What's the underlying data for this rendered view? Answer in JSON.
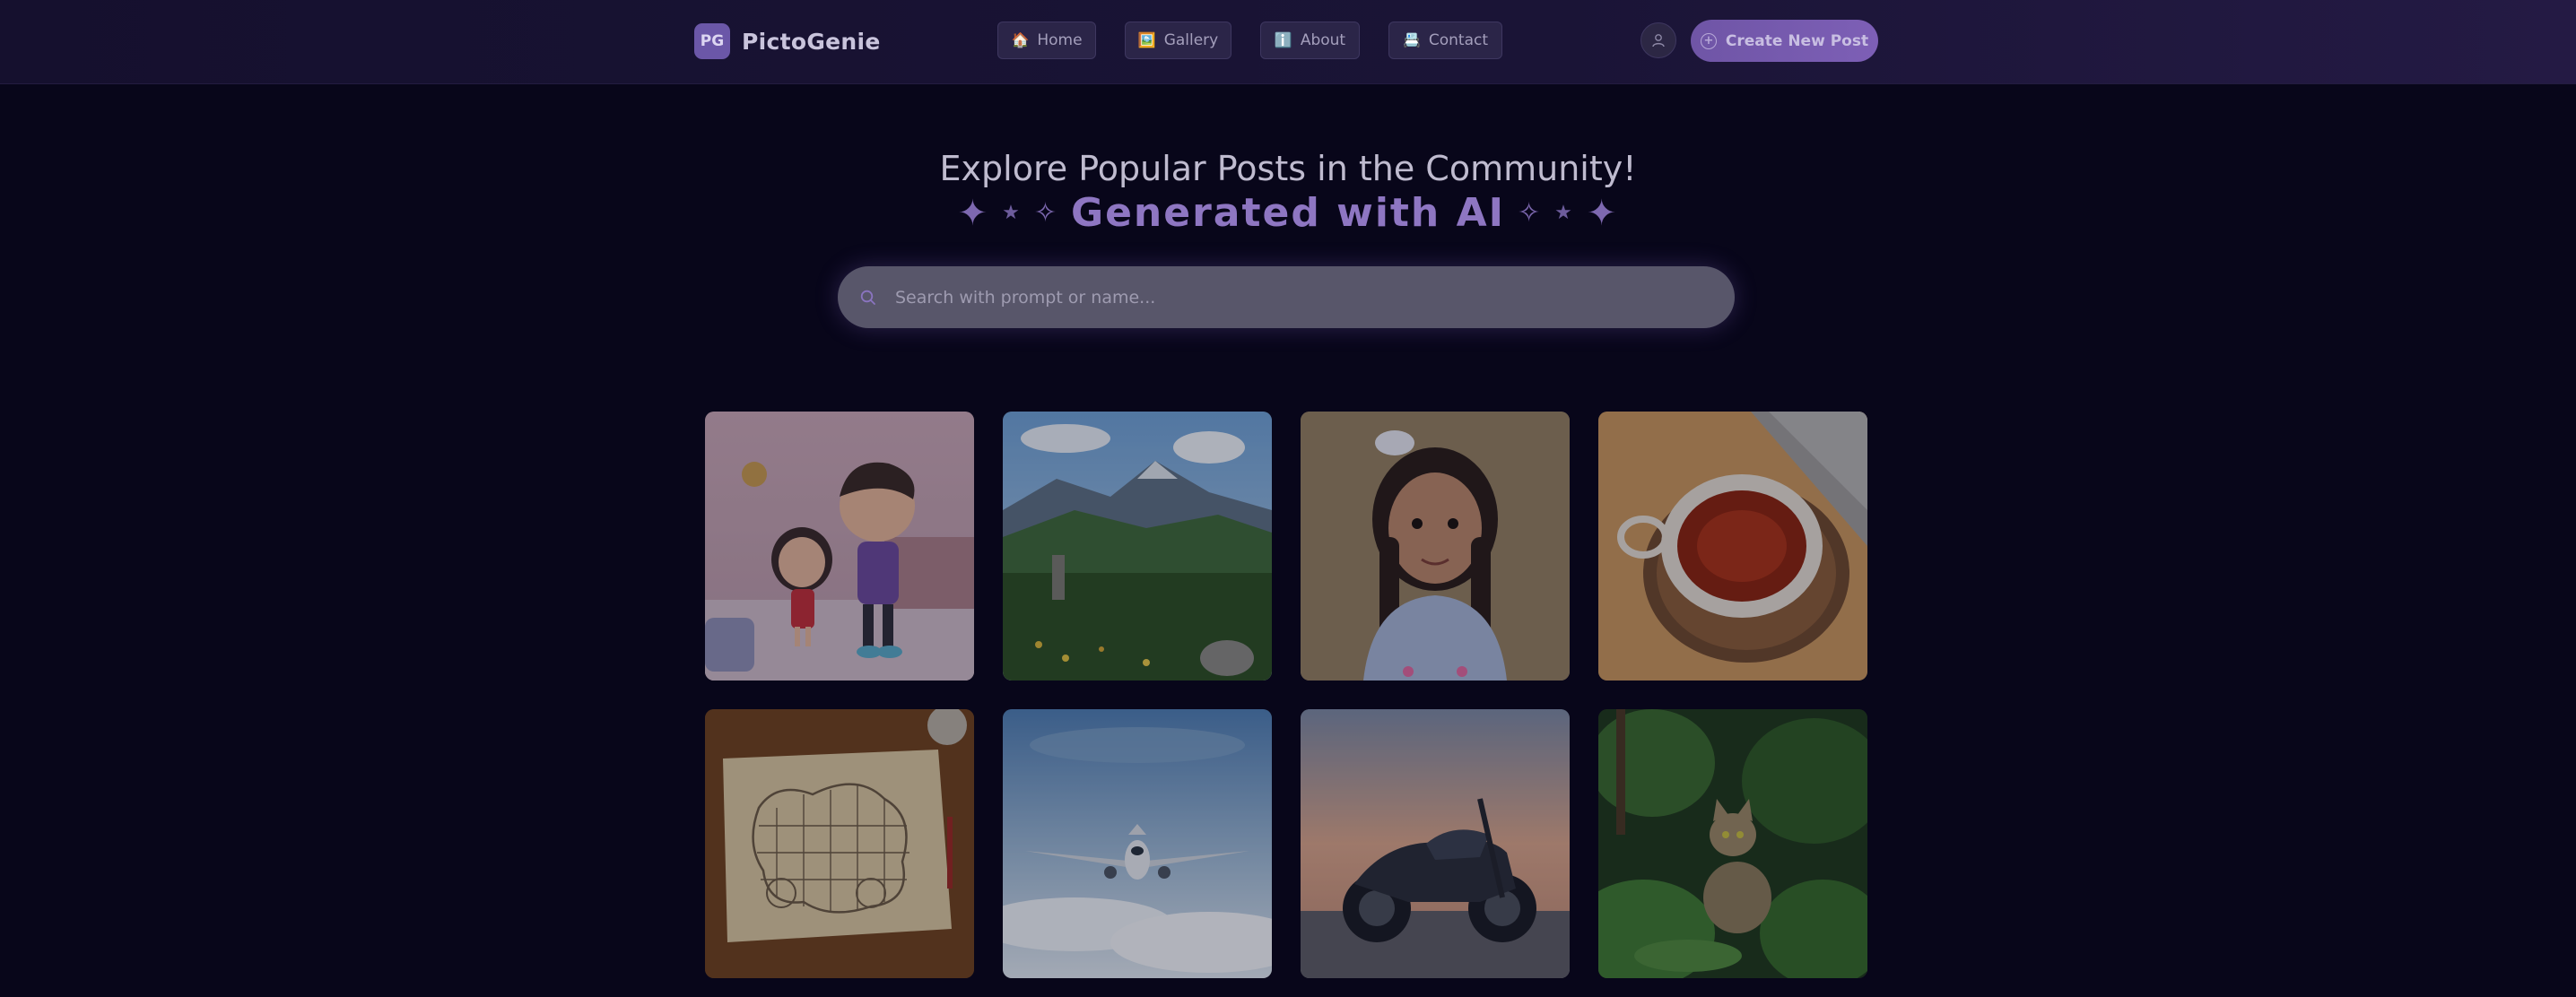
{
  "brand": {
    "badge": "PG",
    "name": "PictoGenie"
  },
  "nav": {
    "items": [
      {
        "label": "Home",
        "icon": "house-icon"
      },
      {
        "label": "Gallery",
        "icon": "picture-icon"
      },
      {
        "label": "About",
        "icon": "info-icon"
      },
      {
        "label": "Contact",
        "icon": "id-card-icon"
      }
    ],
    "profile_icon": "user-icon",
    "create_label": "Create New Post"
  },
  "hero": {
    "title": "Explore Popular Posts in the Community!",
    "subtitle": "Generated with AI"
  },
  "search": {
    "placeholder": "Search with prompt or name..."
  },
  "gallery": {
    "posts": [
      {
        "image": "cartoon-kids-image"
      },
      {
        "image": "mountain-landscape-image"
      },
      {
        "image": "girl-portrait-image"
      },
      {
        "image": "tea-cup-image"
      },
      {
        "image": "treasure-map-image"
      },
      {
        "image": "airplane-image"
      },
      {
        "image": "motorcycle-image"
      },
      {
        "image": "cat-in-jungle-image"
      }
    ]
  },
  "colors": {
    "background": "#08061a",
    "navbar": "#1a1436",
    "accent": "#7d5fb6",
    "subtitle": "#8e76c2"
  }
}
